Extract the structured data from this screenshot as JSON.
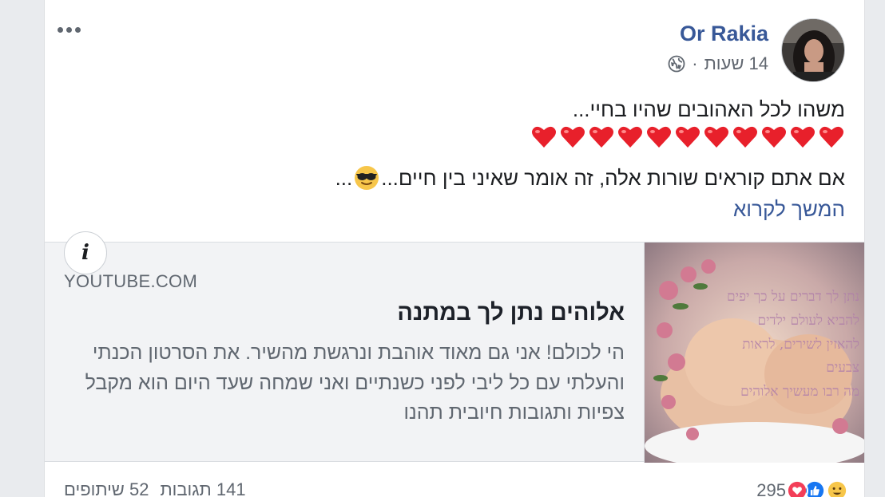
{
  "post": {
    "author": "Or Rakia",
    "time": "14 שעות",
    "separator": "·",
    "text_line1": "משהו לכל האהובים שהיו בחיי...",
    "heart_count": 11,
    "text_line2_prefix": "אם אתם קוראים שורות אלה, זה אומר שאיני בין חיים...",
    "text_line2_suffix": "...",
    "see_more": "המשך לקרוא"
  },
  "link_preview": {
    "domain": "YOUTUBE.COM",
    "title": "אלוהים נתן לך במתנה",
    "description": "הי לכולם! אני גם מאוד אוהבת ונרגשת מהשיר. את הסרטון הכנתי והעלתי עם כל ליבי לפני כשנתיים ואני שמחה שעד היום הוא מקבל צפיות ותגובות חיובית תהנו",
    "info_glyph": "i",
    "thumbnail_text": [
      "נתן לך דברים על כך יפים",
      "להביא לעולם ילדים",
      "להאזין לשירים, לראות",
      "צבעים",
      "מה רבו מעשיך אלוהים"
    ]
  },
  "footer": {
    "reaction_count": "295",
    "comments": "141 תגובות",
    "shares": "52 שיתופים"
  },
  "colors": {
    "link_blue": "#385898",
    "heart_red": "#e8202b",
    "like_blue": "#1877f2",
    "love_red": "#f33e58",
    "haha_yellow": "#f7c64a"
  },
  "icons": {
    "more": "more-horizontal-icon",
    "privacy": "globe-icon",
    "heart": "red-heart-emoji",
    "sunglasses": "sunglasses-emoji",
    "info": "info-icon"
  }
}
